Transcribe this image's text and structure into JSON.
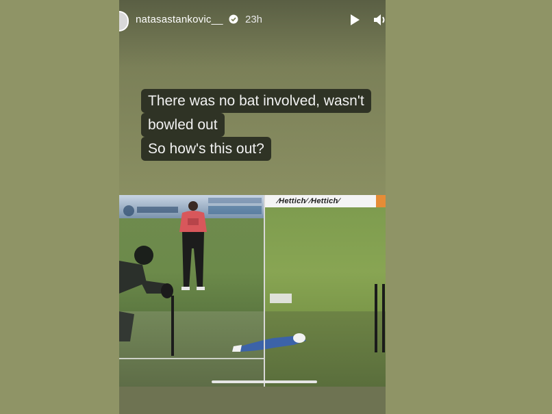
{
  "story": {
    "username": "natasastankovic__",
    "time": "23h",
    "caption_lines": [
      "There was no bat involved, wasn't",
      "bowled out",
      "So how's this out?"
    ],
    "banner_right": "⁄Hettich⁄ ⁄Hettich⁄"
  },
  "colors": {
    "page_bg": "#8f9466",
    "caption_bg": "#2f3325",
    "caption_text": "#f2f2f2"
  },
  "icons": {
    "verified": "verified-badge-icon",
    "play": "play-icon",
    "mute": "speaker-icon"
  }
}
